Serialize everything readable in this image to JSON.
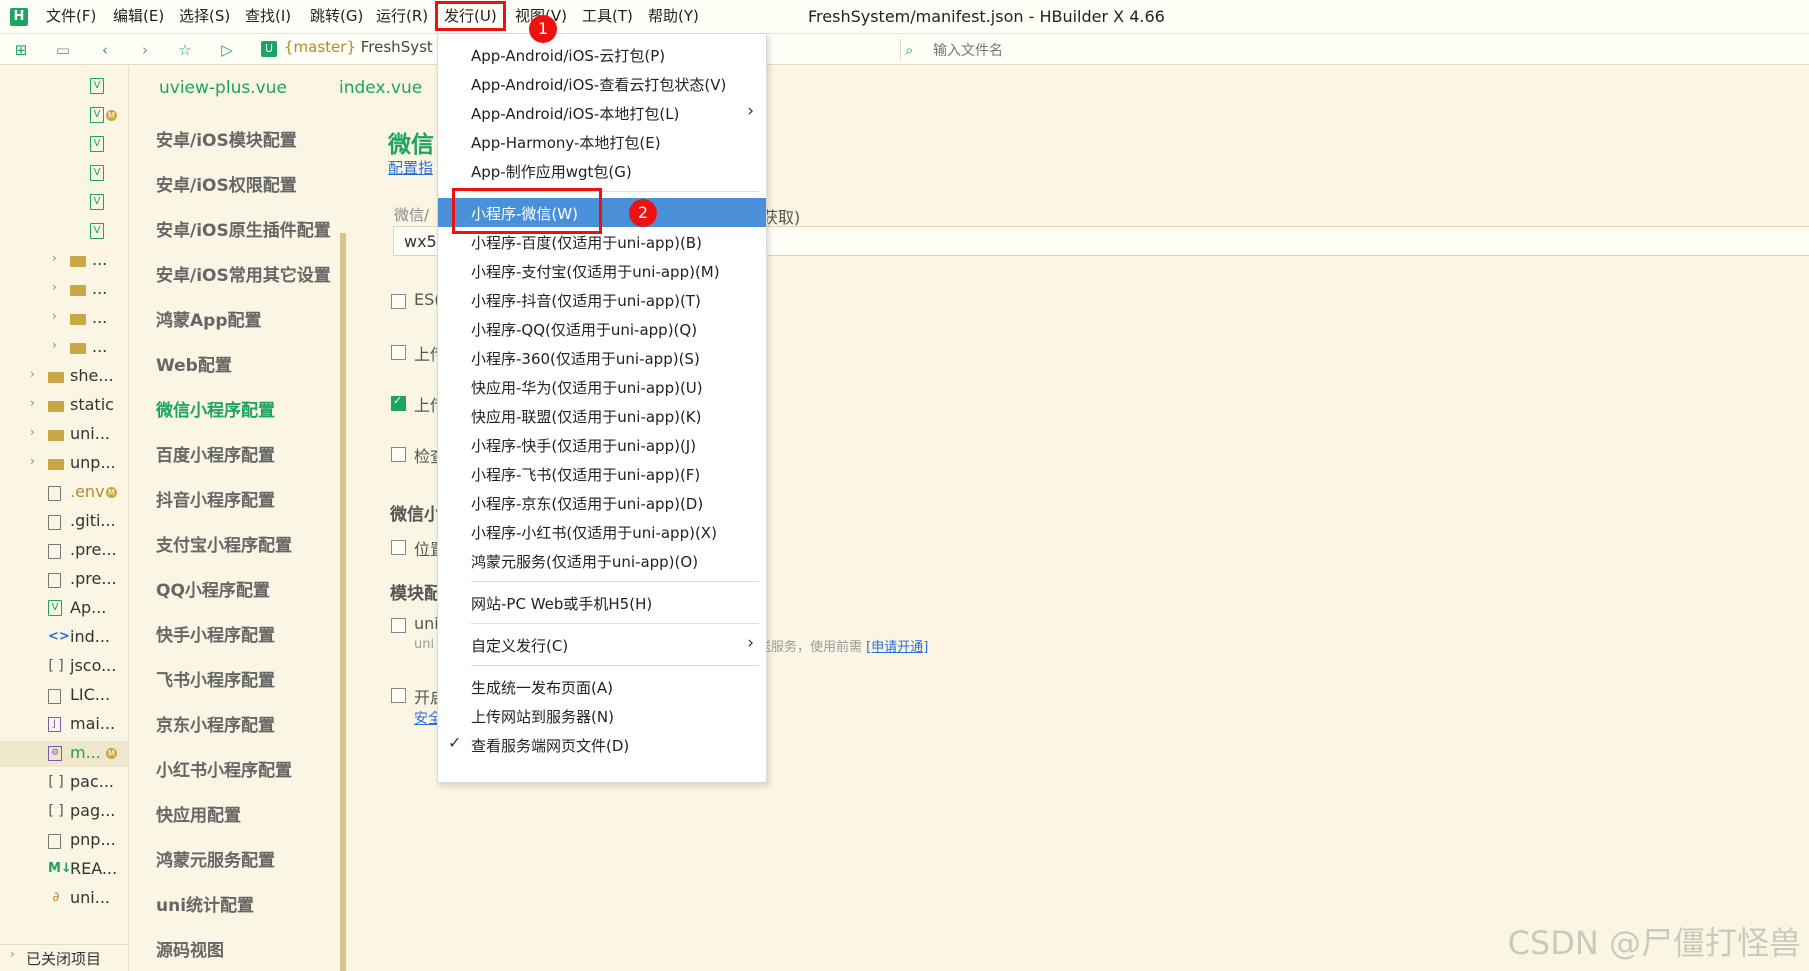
{
  "window": {
    "title": "FreshSystem/manifest.json - HBuilder X 4.66",
    "logo": "H"
  },
  "menubar": [
    {
      "label": "文件(F)"
    },
    {
      "label": "编辑(E)"
    },
    {
      "label": "选择(S)"
    },
    {
      "label": "查找(I)"
    },
    {
      "label": "跳转(G)"
    },
    {
      "label": "运行(R)"
    },
    {
      "label": "发行(U)"
    },
    {
      "label": "视图(V)"
    },
    {
      "label": "工具(T)"
    },
    {
      "label": "帮助(Y)"
    }
  ],
  "toolbar": {
    "icons": [
      "new-file-icon",
      "save-icon",
      "back-icon",
      "forward-icon",
      "star-icon",
      "run-icon"
    ],
    "branch_badge": "U",
    "branch": "{master}",
    "project": "FreshSyst",
    "file_search_placeholder": "输入文件名"
  },
  "file_tree": [
    {
      "label": "",
      "icon": "vue-file-icon"
    },
    {
      "label": "",
      "icon": "vue-file-icon",
      "badge": "M"
    },
    {
      "label": "",
      "icon": "vue-file-icon"
    },
    {
      "label": "",
      "icon": "vue-file-icon"
    },
    {
      "label": "",
      "icon": "vue-file-icon"
    },
    {
      "label": "",
      "icon": "vue-file-icon"
    },
    {
      "label": "...",
      "icon": "folder-icon"
    },
    {
      "label": "...",
      "icon": "folder-icon"
    },
    {
      "label": "...",
      "icon": "folder-icon"
    },
    {
      "label": "...",
      "icon": "folder-icon"
    },
    {
      "label": "she...",
      "icon": "folder-icon"
    },
    {
      "label": "static",
      "icon": "folder-icon"
    },
    {
      "label": "uni...",
      "icon": "folder-icon"
    },
    {
      "label": "unp...",
      "icon": "folder-icon"
    },
    {
      "label": ".env",
      "icon": "file-icon",
      "badge": "M"
    },
    {
      "label": ".giti...",
      "icon": "file-icon"
    },
    {
      "label": ".pre...",
      "icon": "file-icon"
    },
    {
      "label": ".pre...",
      "icon": "file-icon"
    },
    {
      "label": "Ap...",
      "icon": "vue-file-icon"
    },
    {
      "label": "ind...",
      "icon": "html-file-icon"
    },
    {
      "label": "jsco...",
      "icon": "json-file-icon"
    },
    {
      "label": "LIC...",
      "icon": "file-icon"
    },
    {
      "label": "mai...",
      "icon": "js-file-icon"
    },
    {
      "label": "m...",
      "icon": "manifest-file-icon",
      "badge": "M",
      "selected": true
    },
    {
      "label": "pac...",
      "icon": "json-file-icon"
    },
    {
      "label": "pag...",
      "icon": "json-file-icon"
    },
    {
      "label": "pnp...",
      "icon": "file-icon"
    },
    {
      "label": "REA...",
      "icon": "markdown-file-icon"
    },
    {
      "label": "uni...",
      "icon": "link-file-icon"
    }
  ],
  "closed_projects": "已关闭项目",
  "editor_tabs": [
    {
      "label": "uview-plus.vue"
    },
    {
      "label": "index.vue"
    }
  ],
  "settings_nav": [
    {
      "label": "安卓/iOS模块配置"
    },
    {
      "label": "安卓/iOS权限配置"
    },
    {
      "label": "安卓/iOS原生插件配置"
    },
    {
      "label": "安卓/iOS常用其它设置"
    },
    {
      "label": "鸿蒙App配置"
    },
    {
      "label": "Web配置"
    },
    {
      "label": "微信小程序配置",
      "active": true
    },
    {
      "label": "百度小程序配置"
    },
    {
      "label": "抖音小程序配置"
    },
    {
      "label": "支付宝小程序配置"
    },
    {
      "label": "QQ小程序配置"
    },
    {
      "label": "快手小程序配置"
    },
    {
      "label": "飞书小程序配置"
    },
    {
      "label": "京东小程序配置"
    },
    {
      "label": "小红书小程序配置"
    },
    {
      "label": "快应用配置"
    },
    {
      "label": "鸿蒙元服务配置"
    },
    {
      "label": "uni统计配置"
    },
    {
      "label": "源码视图"
    }
  ],
  "content": {
    "heading": "微信",
    "config_link": "配置指",
    "appid_label": "微信/",
    "appid_hint": "获取)",
    "appid_value": "wx5",
    "checkboxes": [
      {
        "label": "ES(",
        "checked": false
      },
      {
        "label": "上传",
        "checked": false
      },
      {
        "label": "上传",
        "checked": true
      },
      {
        "label": "检查",
        "checked": false
      }
    ],
    "section_wechat": "微信小",
    "location_checkbox": {
      "label": "位置",
      "checked": false
    },
    "section_module": "模块配",
    "uni_checkbox": {
      "label": "uni",
      "checked": false
    },
    "uni_sub": "uni",
    "service_note": "送服务，使用前需",
    "service_link": "[申请开通]",
    "open_checkbox": {
      "label": "开启",
      "checked": false
    },
    "safety_link": "安全"
  },
  "publish_menu": {
    "groups": [
      [
        {
          "label": "App-Android/iOS-云打包(P)"
        },
        {
          "label": "App-Android/iOS-查看云打包状态(V)"
        },
        {
          "label": "App-Android/iOS-本地打包(L)",
          "submenu": true
        },
        {
          "label": "App-Harmony-本地打包(E)"
        },
        {
          "label": "App-制作应用wgt包(G)"
        }
      ],
      [
        {
          "label": "小程序-微信(W)",
          "highlight": true
        },
        {
          "label": "小程序-百度(仅适用于uni-app)(B)"
        },
        {
          "label": "小程序-支付宝(仅适用于uni-app)(M)"
        },
        {
          "label": "小程序-抖音(仅适用于uni-app)(T)"
        },
        {
          "label": "小程序-QQ(仅适用于uni-app)(Q)"
        },
        {
          "label": "小程序-360(仅适用于uni-app)(S)"
        },
        {
          "label": "快应用-华为(仅适用于uni-app)(U)"
        },
        {
          "label": "快应用-联盟(仅适用于uni-app)(K)"
        },
        {
          "label": "小程序-快手(仅适用于uni-app)(J)"
        },
        {
          "label": "小程序-飞书(仅适用于uni-app)(F)"
        },
        {
          "label": "小程序-京东(仅适用于uni-app)(D)"
        },
        {
          "label": "小程序-小红书(仅适用于uni-app)(X)"
        },
        {
          "label": "鸿蒙元服务(仅适用于uni-app)(O)"
        }
      ],
      [
        {
          "label": "网站-PC Web或手机H5(H)"
        }
      ],
      [
        {
          "label": "自定义发行(C)",
          "submenu": true
        }
      ],
      [
        {
          "label": "生成统一发布页面(A)"
        },
        {
          "label": "上传网站到服务器(N)"
        },
        {
          "label": "查看服务端网页文件(D)",
          "checked": true
        }
      ]
    ]
  },
  "annotations": {
    "step1": "1",
    "step2": "2"
  },
  "watermark": "CSDN @尸僵打怪兽",
  "colors": {
    "accent": "#1DA462",
    "highlight": "#4A90D9",
    "annotation": "#EE1111",
    "background": "#FBF6E3"
  }
}
